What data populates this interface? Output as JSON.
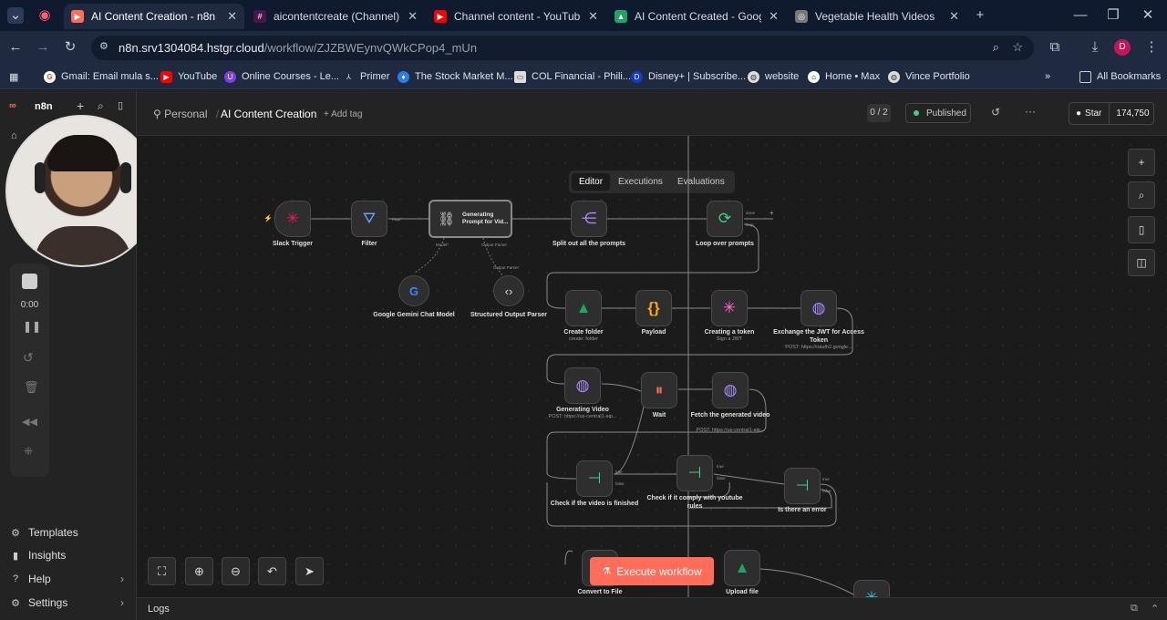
{
  "browser": {
    "tabs": [
      {
        "label": "AI Content Creation - n8n",
        "active": true
      },
      {
        "label": "aicontentcreate (Channel) - AIC"
      },
      {
        "label": "Channel content - YouTube Stu"
      },
      {
        "label": "AI Content Created - Google Dr"
      },
      {
        "label": "Vegetable Health Videos"
      }
    ],
    "url_host": "n8n.srv1304084.hstgr.cloud",
    "url_path": "/workflow/ZJZBWEynvQWkCPop4_mUn",
    "profile_initial": "D",
    "bookmarks": [
      "Gmail: Email mula s...",
      "YouTube",
      "Online Courses - Le...",
      "Primer",
      "The Stock Market M...",
      "COL Financial - Phili...",
      "Disney+ | Subscribe...",
      "website",
      "Home • Max",
      "Vince Portfolio"
    ],
    "all_bookmarks": "All Bookmarks"
  },
  "n8n": {
    "brand": "n8n",
    "breadcrumb_project": "Personal",
    "workflow_name": "AI Content Creation",
    "add_tag": "+ Add tag",
    "counter": "0 / 2",
    "status": "Published",
    "star_label": "Star",
    "star_count": "174,750",
    "tabs": [
      "Editor",
      "Executions",
      "Evaluations"
    ],
    "active_tab": "Editor",
    "sidebar_bottom": [
      "Templates",
      "Insights",
      "Help",
      "Settings"
    ],
    "recorder_time": "0:00",
    "execute_button": "Execute workflow",
    "logs_label": "Logs"
  },
  "nodes": {
    "slack_trigger": "Slack Trigger",
    "filter": "Filter",
    "generating_prompt": "Generating Prompt for Vid...",
    "split_out": "Split out all the prompts",
    "loop": "Loop over prompts",
    "gemini": "Google Gemini Chat Model",
    "parser": "Structured Output Parser",
    "create_folder": "Create folder",
    "create_folder_sub": "create: folder",
    "payload": "Payload",
    "creating_token": "Creating a token",
    "creating_token_sub": "Sign a JWT",
    "exchange_jwt": "Exchange the JWT for Access Token",
    "exchange_jwt_sub": "POST: https://oauth2.google...",
    "generating_video": "Generating Video",
    "generating_video_sub": "POST: https://us-central1-aip...",
    "wait": "Wait",
    "fetch_video": "Fetch the generated video",
    "fetch_video_sub": "POST: https://us-central1-aip...",
    "check_finished": "Check if the video is finished",
    "check_rules": "Check if it comply with youtube rules",
    "is_error": "Is there an error",
    "convert_file": "Convert to File",
    "upload_file": "Upload file"
  },
  "ports": {
    "kept": "Kept",
    "model": "Model*",
    "output_parser": "Output Parser",
    "done": "done",
    "loop": "loop",
    "true": "true",
    "false": "false"
  },
  "colors": {
    "execute": "#ff6d5a",
    "published_dot": "#3ecf8e",
    "accent_purple": "#a78bfa"
  }
}
